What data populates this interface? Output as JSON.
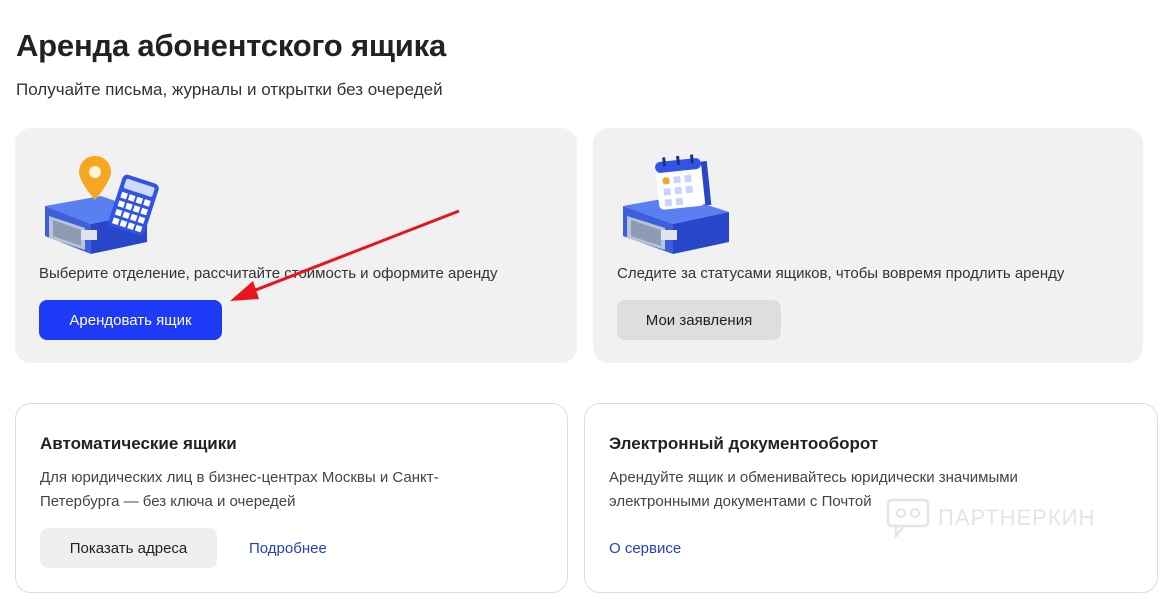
{
  "page": {
    "title": "Аренда абонентского ящика",
    "subtitle": "Получайте письма, журналы и открытки без очередей"
  },
  "rent_card": {
    "description": "Выберите отделение, рассчитайте стоимость и оформите аренду",
    "button_label": "Арендовать ящик",
    "illustration_icon": "mailbox-with-location-pin-and-calculator-icon"
  },
  "status_card": {
    "description": "Следите за статусами ящиков, чтобы вовремя продлить аренду",
    "button_label": "Мои заявления",
    "illustration_icon": "mailbox-with-calendar-icon"
  },
  "auto_card": {
    "heading": "Автоматические ящики",
    "description": "Для юридических лиц в бизнес-центрах Москвы и Санкт-Петербурга — без ключа и очередей",
    "button_label": "Показать адреса",
    "link_label": "Подробнее"
  },
  "edo_card": {
    "heading": "Электронный документооборот",
    "description": "Арендуйте ящик и обменивайтесь юридически значимыми электронными документами с Почтой",
    "link_label": "О сервисе"
  },
  "watermark": {
    "text": "ПАРТНЕРКИН"
  },
  "colors": {
    "primary": "#1d3bf6",
    "link": "#2440c9",
    "arrow": "#e8141c",
    "card_bg": "#f1f1f2"
  }
}
